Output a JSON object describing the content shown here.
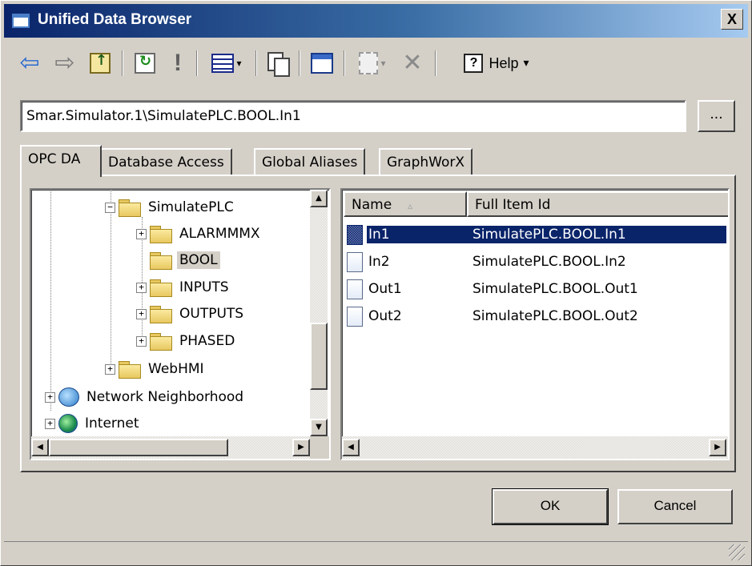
{
  "window": {
    "title": "Unified Data Browser",
    "close_label": "X"
  },
  "toolbar": {
    "items": [
      {
        "name": "back",
        "icon": "back-arrow-icon"
      },
      {
        "name": "forward",
        "icon": "forward-arrow-icon"
      },
      {
        "name": "up-folder",
        "icon": "up-folder-icon"
      },
      {
        "name": "refresh",
        "icon": "refresh-icon"
      },
      {
        "name": "alert",
        "icon": "exclamation-icon"
      },
      {
        "name": "view",
        "icon": "view-menu-icon"
      },
      {
        "name": "copy",
        "icon": "copy-icon"
      },
      {
        "name": "window",
        "icon": "window-icon"
      },
      {
        "name": "new",
        "icon": "new-item-icon"
      },
      {
        "name": "delete",
        "icon": "delete-icon"
      }
    ],
    "exclamation": "!",
    "delete_glyph": "✕",
    "help_icon_glyph": "?",
    "help_label": "Help",
    "dropdown_caret": "▾"
  },
  "address": {
    "value": "Smar.Simulator.1\\SimulatePLC.BOOL.In1",
    "browse_label": "..."
  },
  "tabs": [
    {
      "label": "OPC DA",
      "active": true
    },
    {
      "label": "Database Access",
      "active": false
    },
    {
      "label": "Global Aliases",
      "active": false
    },
    {
      "label": "GraphWorX",
      "active": false
    }
  ],
  "tree": {
    "nodes": [
      {
        "label": "SimulatePLC",
        "expander": "−",
        "icon": "folder-open-icon"
      },
      {
        "label": "ALARMMMX",
        "expander": "+",
        "icon": "folder-icon"
      },
      {
        "label": "BOOL",
        "expander": "",
        "icon": "folder-open-icon",
        "selected": true
      },
      {
        "label": "INPUTS",
        "expander": "+",
        "icon": "folder-icon"
      },
      {
        "label": "OUTPUTS",
        "expander": "+",
        "icon": "folder-icon"
      },
      {
        "label": "PHASED",
        "expander": "+",
        "icon": "folder-icon"
      },
      {
        "label": "WebHMI",
        "expander": "+",
        "icon": "folder-icon"
      },
      {
        "label": "Network Neighborhood",
        "expander": "+",
        "icon": "network-icon"
      },
      {
        "label": "Internet",
        "expander": "+",
        "icon": "globe-icon"
      }
    ]
  },
  "list": {
    "columns": [
      "Name",
      "Full Item Id"
    ],
    "sort_indicator": "▵",
    "rows": [
      {
        "name": "In1",
        "full_id": "SimulatePLC.BOOL.In1",
        "selected": true
      },
      {
        "name": "In2",
        "full_id": "SimulatePLC.BOOL.In2"
      },
      {
        "name": "Out1",
        "full_id": "SimulatePLC.BOOL.Out1"
      },
      {
        "name": "Out2",
        "full_id": "SimulatePLC.BOOL.Out2"
      }
    ]
  },
  "scroll": {
    "up": "▲",
    "down": "▼",
    "left": "◀",
    "right": "▶"
  },
  "buttons": {
    "ok": "OK",
    "cancel": "Cancel"
  }
}
